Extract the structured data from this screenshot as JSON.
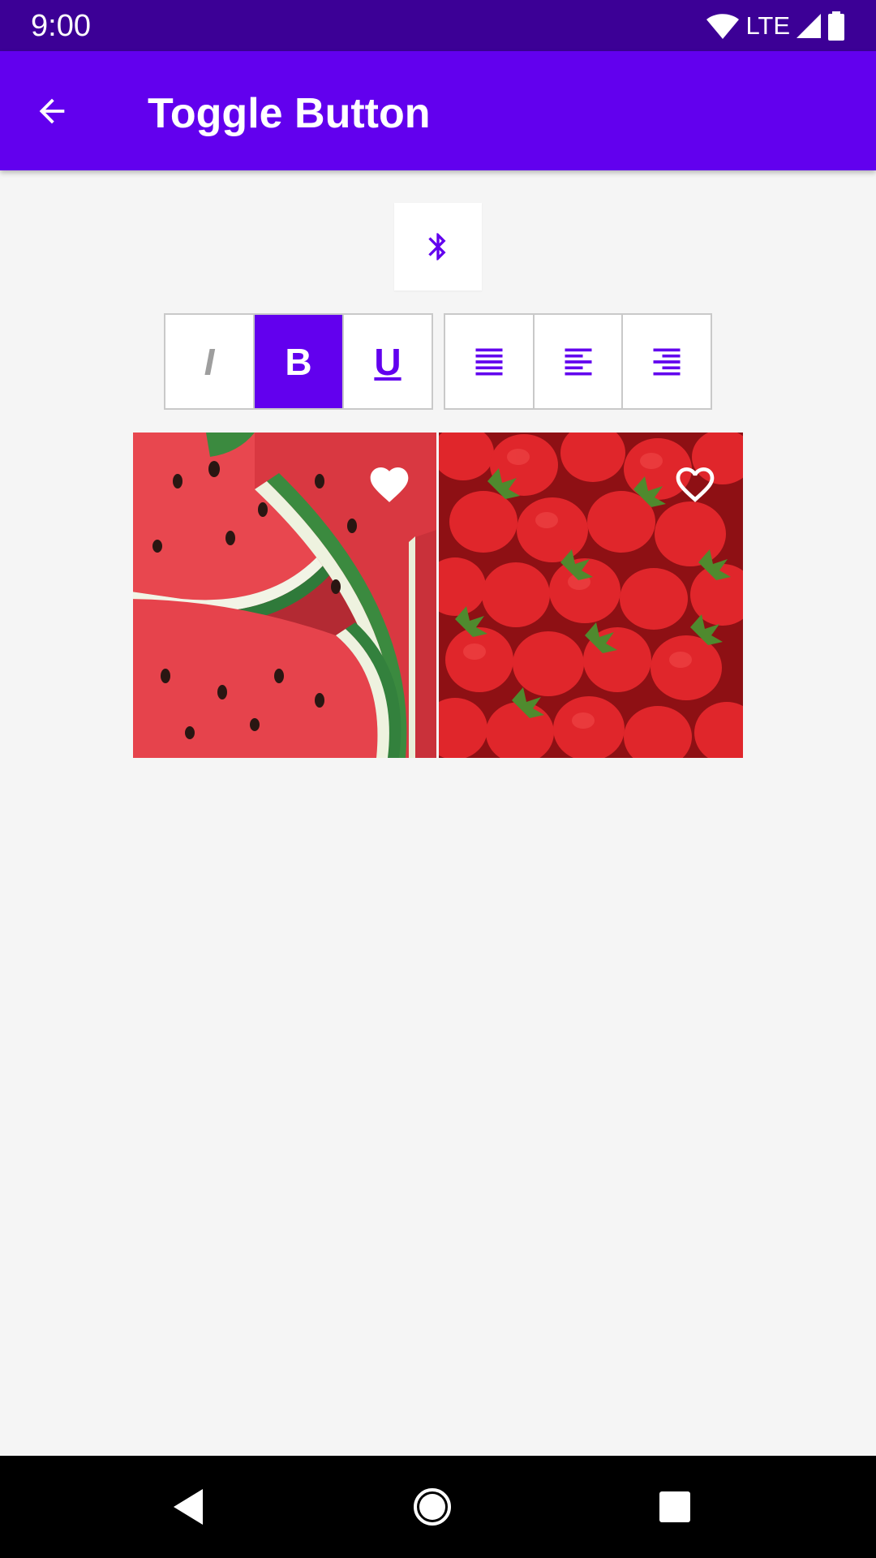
{
  "status_bar": {
    "time": "9:00",
    "network": "LTE"
  },
  "app_bar": {
    "title": "Toggle Button",
    "back_icon": "arrow-back-icon"
  },
  "bluetooth_toggle": {
    "icon": "bluetooth-icon",
    "checked": false
  },
  "format_group": [
    {
      "label": "I",
      "style": "italic",
      "checked": false
    },
    {
      "label": "B",
      "style": "bold",
      "checked": true
    },
    {
      "label": "U",
      "style": "underline",
      "checked": false
    }
  ],
  "align_group": [
    {
      "icon": "format-justify-icon",
      "checked": false
    },
    {
      "icon": "format-align-left-icon",
      "checked": false
    },
    {
      "icon": "format-align-right-icon",
      "checked": false
    }
  ],
  "image_cards": [
    {
      "subject": "watermelon",
      "favorite": true,
      "icon": "heart-filled-icon"
    },
    {
      "subject": "strawberries",
      "favorite": false,
      "icon": "heart-outline-icon"
    }
  ],
  "colors": {
    "primary": "#6200ee",
    "primary_dark": "#3c0096",
    "background": "#f5f5f5",
    "on_primary": "#ffffff"
  }
}
